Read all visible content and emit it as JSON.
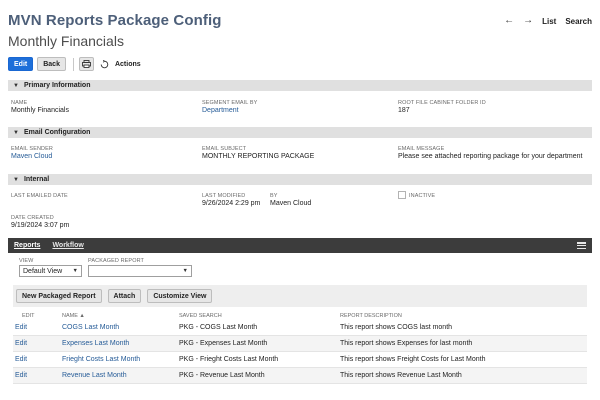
{
  "record": {
    "type_title": "MVN Reports Package Config",
    "name": "Monthly Financials"
  },
  "top_nav": {
    "back_arrow": "←",
    "forward_arrow": "→",
    "list": "List",
    "search": "Search"
  },
  "toolbar": {
    "edit": "Edit",
    "back": "Back",
    "print_icon": "printer-icon",
    "actions_icon": "actions-icon",
    "actions": "Actions"
  },
  "sections": {
    "primary": {
      "title": "Primary Information",
      "name_label": "NAME",
      "name_value": "Monthly Financials",
      "segment_label": "SEGMENT EMAIL BY",
      "segment_value": "Department",
      "root_label": "ROOT FILE CABINET FOLDER ID",
      "root_value": "187"
    },
    "email": {
      "title": "Email Configuration",
      "sender_label": "EMAIL SENDER",
      "sender_value": "Maven Cloud",
      "subject_label": "EMAIL SUBJECT",
      "subject_value": "MONTHLY REPORTING PACKAGE",
      "message_label": "EMAIL MESSAGE",
      "message_value": "Please see attached reporting package for your department"
    },
    "internal": {
      "title": "Internal",
      "last_emailed_label": "LAST EMAILED DATE",
      "last_modified_label": "LAST MODIFIED",
      "last_modified_value": "9/26/2024 2:29 pm",
      "by_label": "BY",
      "by_value": "Maven Cloud",
      "inactive_label": "INACTIVE",
      "inactive_checked": false,
      "date_created_label": "DATE CREATED",
      "date_created_value": "9/19/2024 3:07 pm"
    }
  },
  "subtabs": {
    "reports": "Reports",
    "workflow": "Workflow"
  },
  "filters": {
    "view_label": "VIEW",
    "view_value": "Default View",
    "packaged_label": "PACKAGED REPORT",
    "packaged_value": ""
  },
  "sublist": {
    "buttons": {
      "new": "New Packaged Report",
      "attach": "Attach",
      "customize": "Customize View"
    },
    "headers": {
      "edit": "EDIT",
      "name": "NAME ▲",
      "saved_search": "SAVED SEARCH",
      "description": "REPORT DESCRIPTION"
    },
    "rows": [
      {
        "edit": "Edit",
        "name": "COGS Last Month",
        "saved_search": "PKG - COGS Last Month",
        "description": "This report shows COGS last month"
      },
      {
        "edit": "Edit",
        "name": "Expenses Last Month",
        "saved_search": "PKG - Expenses Last Month",
        "description": "This report shows Expenses for last month"
      },
      {
        "edit": "Edit",
        "name": "Frieght Costs Last Month",
        "saved_search": "PKG - Frieght Costs Last Month",
        "description": "This report shows Freight Costs for Last Month"
      },
      {
        "edit": "Edit",
        "name": "Revenue Last Month",
        "saved_search": "PKG - Revenue Last Month",
        "description": "This report shows Revenue Last Month"
      }
    ]
  },
  "colors": {
    "primary_button": "#1e6fd9",
    "title": "#4d5f79",
    "link": "#255b97",
    "subtab_bar": "#3c3c3c",
    "section_header": "#e0e0e0"
  }
}
